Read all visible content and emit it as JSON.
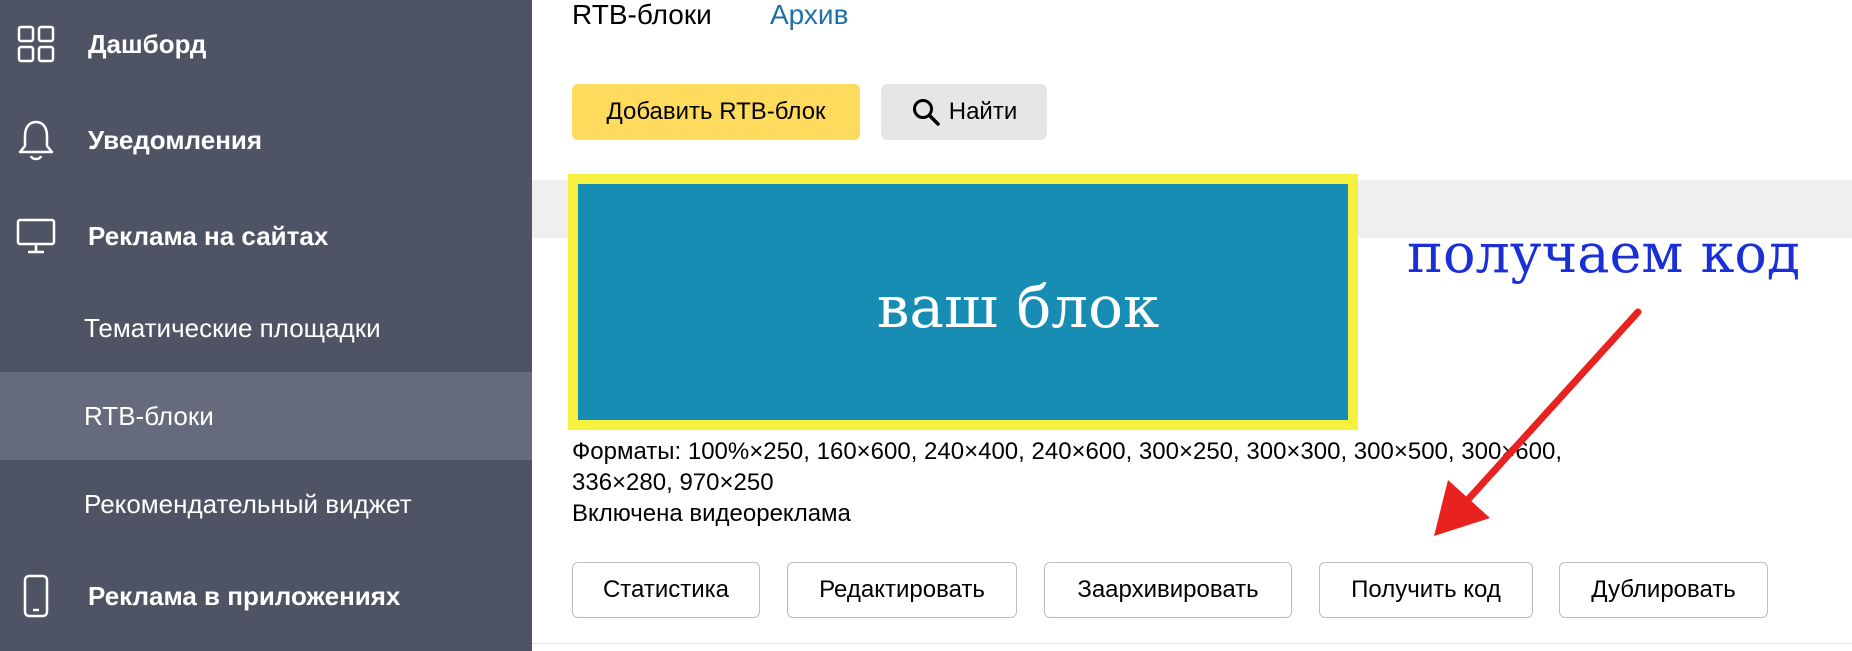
{
  "sidebar": {
    "items": [
      {
        "label": "Дашборд",
        "icon": "dashboard-icon"
      },
      {
        "label": "Уведомления",
        "icon": "bell-icon"
      },
      {
        "label": "Реклама на сайтах",
        "icon": "monitor-icon"
      },
      {
        "label": "Тематические площадки"
      },
      {
        "label": "RTB-блоки",
        "active": true
      },
      {
        "label": "Рекомендательный виджет"
      },
      {
        "label": "Реклама в приложениях",
        "icon": "phone-icon"
      }
    ]
  },
  "tabs": {
    "rtb": "RTB-блоки",
    "archive": "Архив"
  },
  "toolbar": {
    "add_label": "Добавить RTB-блок",
    "find_label": "Найти"
  },
  "block": {
    "preview_text": "ваш блок",
    "formats_line1": "Форматы:  100%×250, 160×600, 240×400, 240×600, 300×250, 300×300, 300×500, 300×600,",
    "formats_line2": "336×280, 970×250",
    "video_note": "Включена видеореклама"
  },
  "actions": {
    "statistics": "Статистика",
    "edit": "Редактировать",
    "archive": "Заархивировать",
    "get_code": "Получить код",
    "duplicate": "Дублировать"
  },
  "annotation": {
    "text": "получаем код"
  },
  "colors": {
    "sidebar_bg": "#4f5464",
    "sidebar_active": "#656b7d",
    "accent_yellow": "#fedb5c",
    "preview_bg": "#178db3",
    "preview_border": "#f6f03f",
    "annotation_blue": "#1a2fd6",
    "arrow_red": "#e8231f",
    "link_blue": "#1f6fa8"
  }
}
